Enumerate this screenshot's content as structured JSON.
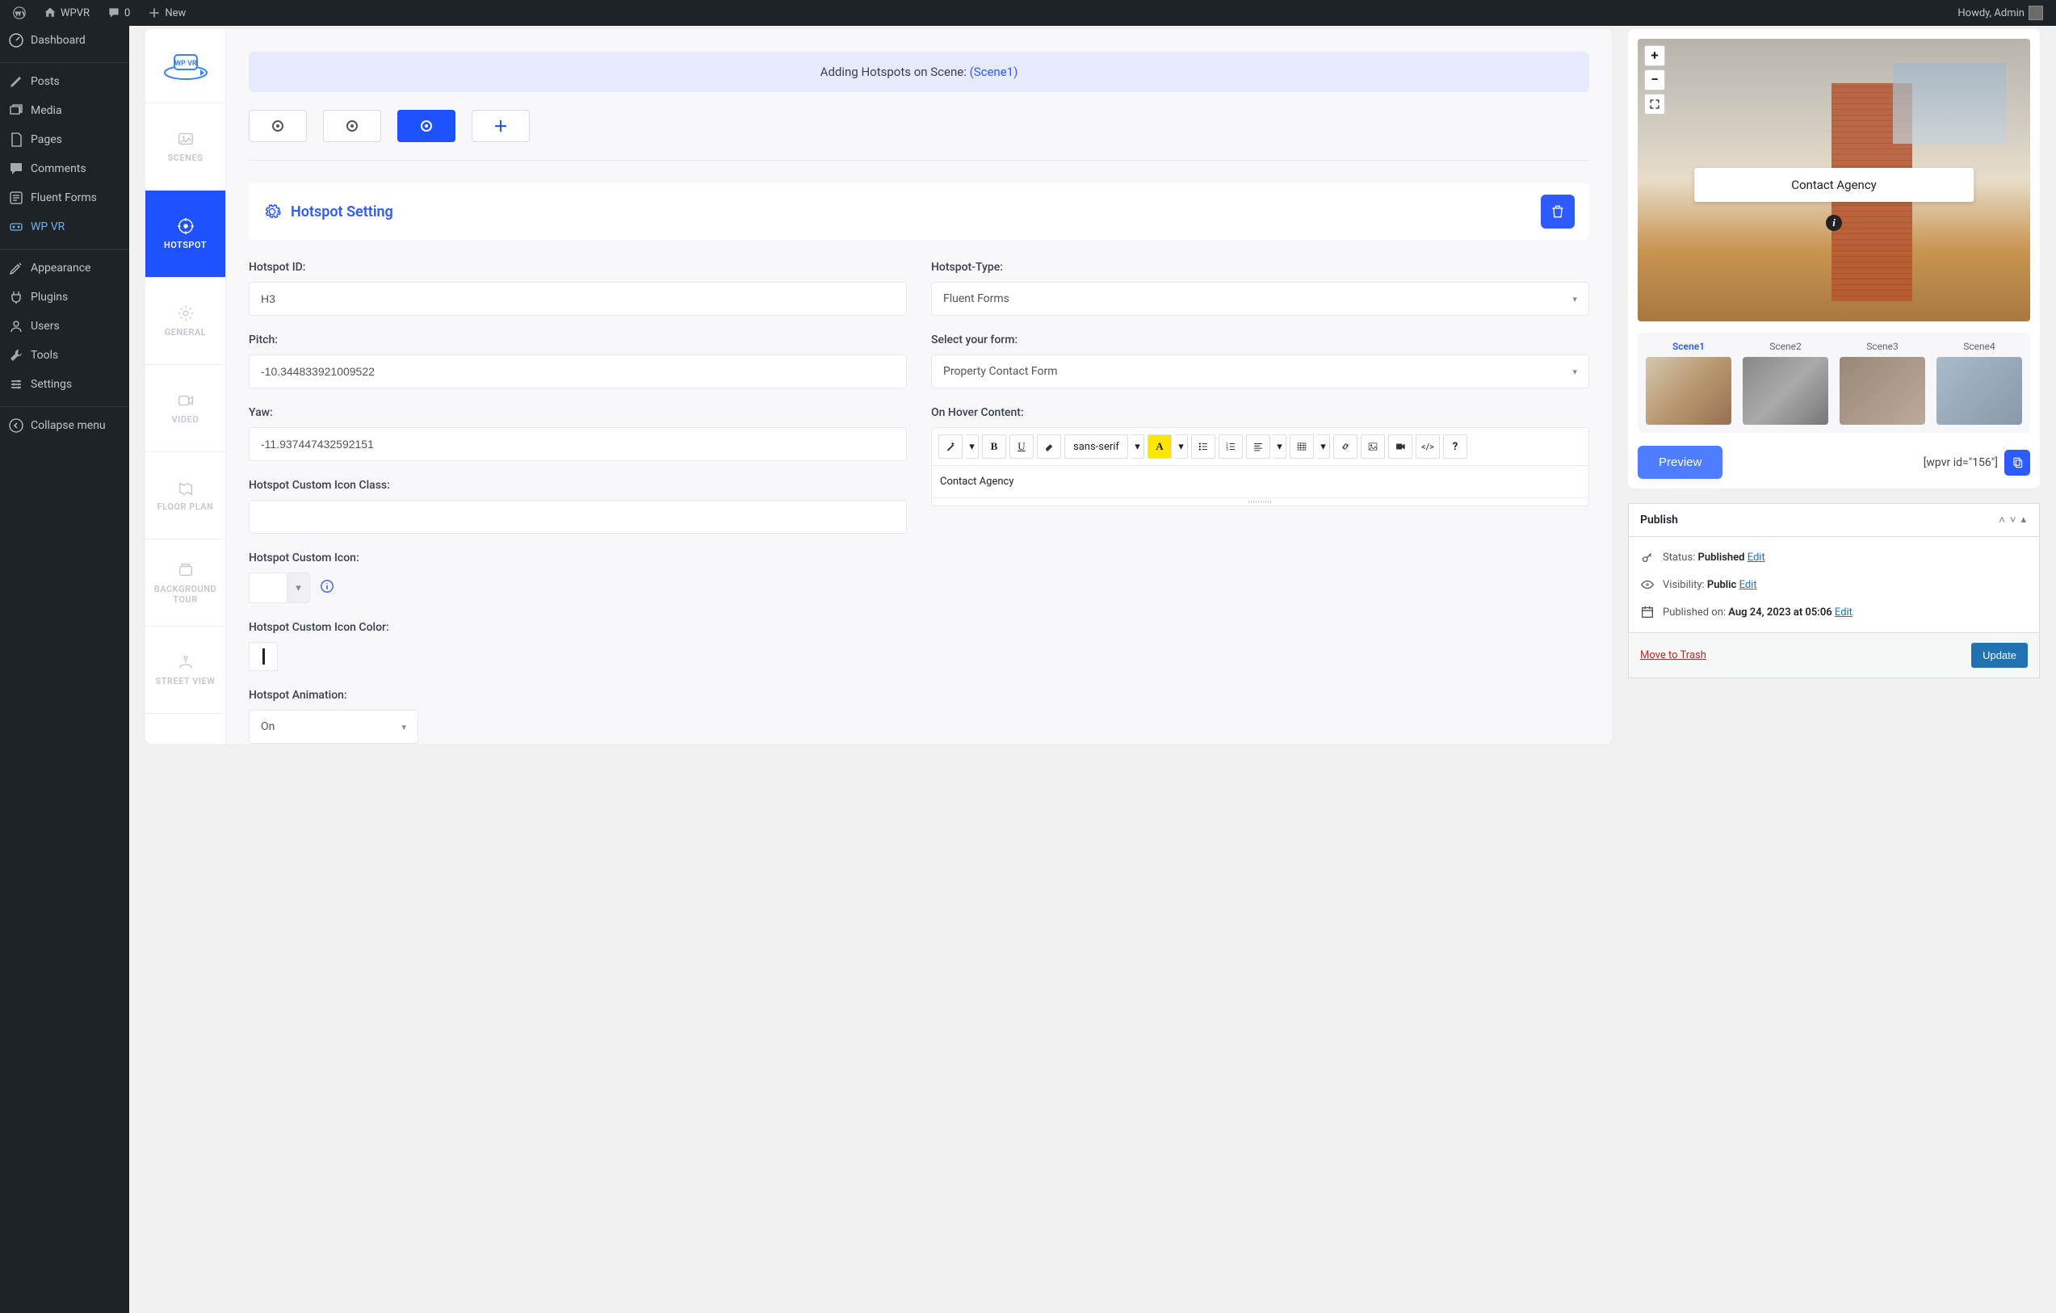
{
  "adminBar": {
    "site": "WPVR",
    "comments": "0",
    "new": "New",
    "howdy": "Howdy, Admin"
  },
  "wpMenu": {
    "dashboard": "Dashboard",
    "posts": "Posts",
    "media": "Media",
    "pages": "Pages",
    "comments": "Comments",
    "fluentforms": "Fluent Forms",
    "wpvr": "WP VR",
    "appearance": "Appearance",
    "plugins": "Plugins",
    "users": "Users",
    "tools": "Tools",
    "settings": "Settings",
    "collapse": "Collapse menu"
  },
  "wpvrTabs": {
    "scenes": "SCENES",
    "hotspot": "HOTSPOT",
    "general": "GENERAL",
    "video": "VIDEO",
    "floorplan": "FLOOR PLAN",
    "bgtour": "BACKGROUND TOUR",
    "streetview": "STREET VIEW"
  },
  "banner": {
    "prefix": "Adding Hotspots on Scene: ",
    "scene": "(Scene1)"
  },
  "settingHeader": "Hotspot Setting",
  "labels": {
    "hotspotId": "Hotspot ID:",
    "hotspotType": "Hotspot-Type:",
    "pitch": "Pitch:",
    "selectForm": "Select your form:",
    "yaw": "Yaw:",
    "onHover": "On Hover Content:",
    "iconClass": "Hotspot Custom Icon Class:",
    "customIcon": "Hotspot Custom Icon:",
    "iconColor": "Hotspot Custom Icon Color:",
    "animation": "Hotspot Animation:"
  },
  "values": {
    "hotspotId": "H3",
    "hotspotType": "Fluent Forms",
    "pitch": "-10.344833921009522",
    "form": "Property Contact Form",
    "yaw": "-11.937447432592151",
    "iconClass": "",
    "hoverContent": "Contact Agency",
    "animation": "On"
  },
  "rte": {
    "font": "sans-serif",
    "bold": "B",
    "underline": "U",
    "html": "</>",
    "help": "?"
  },
  "preview": {
    "label": "Contact Agency",
    "button": "Preview",
    "shortcode": "[wpvr id=\"156\"]",
    "scenes": [
      "Scene1",
      "Scene2",
      "Scene3",
      "Scene4"
    ]
  },
  "publish": {
    "title": "Publish",
    "statusLabel": "Status: ",
    "statusValue": "Published",
    "visibilityLabel": "Visibility: ",
    "visibilityValue": "Public",
    "publishedLabel": "Published on: ",
    "publishedValue": "Aug 24, 2023 at 05:06",
    "edit": "Edit",
    "trash": "Move to Trash",
    "update": "Update"
  }
}
